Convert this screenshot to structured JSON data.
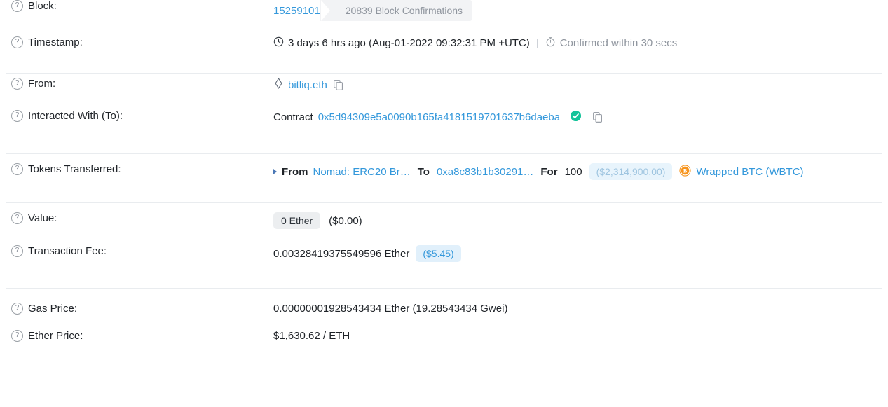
{
  "rows": {
    "block": {
      "label": "Block:",
      "number": "15259101",
      "confirmations": "20839 Block Confirmations"
    },
    "timestamp": {
      "label": "Timestamp:",
      "age_and_date": "3 days 6 hrs ago (Aug-01-2022 09:32:31 PM +UTC)",
      "separator": "|",
      "confirmed_note": "Confirmed within 30 secs"
    },
    "from": {
      "label": "From:",
      "address_name": "bitliq.eth"
    },
    "to": {
      "label": "Interacted With (To):",
      "prefix": "Contract",
      "address": "0x5d94309e5a0090b165fa4181519701637b6daeba"
    },
    "tokens_transferred": {
      "label": "Tokens Transferred:",
      "from_word": "From",
      "from_name": "Nomad: ERC20 Br…",
      "to_word": "To",
      "to_address": "0xa8c83b1b30291…",
      "for_word": "For",
      "amount": "100",
      "usd_value": "($2,314,900.00)",
      "token_name": "Wrapped BTC (WBTC)"
    },
    "value": {
      "label": "Value:",
      "amount": "0 Ether",
      "usd": "($0.00)"
    },
    "transaction_fee": {
      "label": "Transaction Fee:",
      "amount": "0.00328419375549596 Ether",
      "usd": "($5.45)"
    },
    "gas_price": {
      "label": "Gas Price:",
      "amount": "0.00000001928543434 Ether (19.28543434 Gwei)"
    },
    "ether_price": {
      "label": "Ether Price:",
      "amount": "$1,630.62 / ETH"
    }
  },
  "colors": {
    "link": "#3498db",
    "muted": "#8f959e",
    "verified_green": "#15c39a",
    "btc_orange": "#f7931a",
    "badge_grey": "#f2f3f5",
    "badge_blue": "#e8f4fc"
  }
}
